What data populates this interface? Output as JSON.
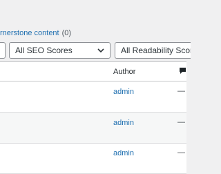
{
  "views": {
    "cornerstone_label": "rnerstone content",
    "cornerstone_count": "(0)"
  },
  "filters": {
    "seo_scores": "All SEO Scores",
    "readability_scores": "All Readability Scores"
  },
  "table": {
    "columns": {
      "author": "Author",
      "comments_icon": "comment-bubble-icon"
    },
    "rows": [
      {
        "author": "admin",
        "comments": "—"
      },
      {
        "author": "admin",
        "comments": "—"
      },
      {
        "author": "admin",
        "comments": "—"
      }
    ]
  },
  "colors": {
    "link": "#2271b1",
    "background": "#f0f0f1",
    "border": "#8c8f94"
  }
}
